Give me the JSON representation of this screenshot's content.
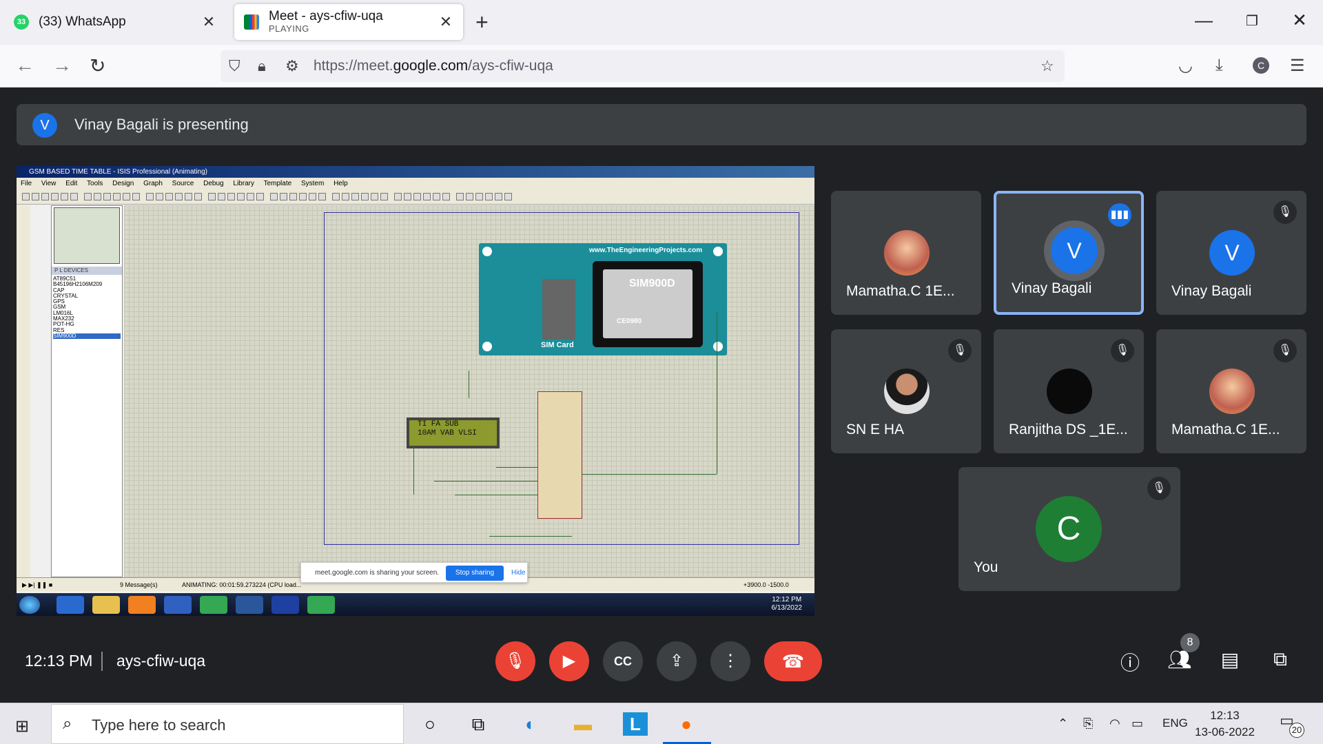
{
  "browser": {
    "tabs": [
      {
        "title": "(33) WhatsApp",
        "badge": "33"
      },
      {
        "title": "Meet - ays-cfiw-uqa",
        "subtitle": "PLAYING"
      }
    ],
    "url_prefix": "https://meet.",
    "url_domain": "google.com",
    "url_path": "/ays-cfiw-uqa",
    "profile_initial": "C"
  },
  "meet": {
    "presenter_initial": "V",
    "presenting_text": "Vinay Bagali is presenting",
    "time": "12:13 PM",
    "meeting_code": "ays-cfiw-uqa",
    "people_count": "8",
    "participants": [
      {
        "name": "Mamatha.C 1E...",
        "muted": false,
        "speaking": false
      },
      {
        "name": "Vinay Bagali",
        "initial": "V",
        "speaking": true
      },
      {
        "name": "Vinay Bagali",
        "initial": "V",
        "muted": true
      },
      {
        "name": "SN E HA",
        "muted": true
      },
      {
        "name": "Ranjitha DS _1E...",
        "muted": true
      },
      {
        "name": "Mamatha.C 1E...",
        "muted": true
      },
      {
        "name": "You",
        "initial": "C",
        "muted": true
      }
    ],
    "colors": {
      "accent": "#1a73e8",
      "danger": "#ea4335",
      "surface": "#3c4043",
      "background": "#202124",
      "you_avatar": "#1e7e34"
    }
  },
  "shared_screen": {
    "window_title": "GSM BASED TIME TABLE - ISIS Professional (Animating)",
    "menu": [
      "File",
      "View",
      "Edit",
      "Tools",
      "Design",
      "Graph",
      "Source",
      "Debug",
      "Library",
      "Template",
      "System",
      "Help"
    ],
    "devices_header": "P  L    DEVICES",
    "devices": [
      "AT89C51",
      "B45196H2106M209",
      "CAP",
      "CRYSTAL",
      "GPS",
      "GSM",
      "LM016L",
      "MAX232",
      "POT-HG",
      "RES",
      "SIM900D"
    ],
    "selected_device": "SIM900D",
    "module_site": "www.TheEngineeringProjects.com",
    "module_chip": "SIM900D",
    "module_ce": "CE0980",
    "module_sim": "SIM Card",
    "lcd_line1": "TI    FA  SUB",
    "lcd_line2": "10AM  VAB  VLSI",
    "status_messages": "9 Message(s)",
    "status_anim": "ANIMATING: 00:01:59.273224 (CPU load...",
    "status_coords": "+3900.0   -1500.0",
    "share_msg": "meet.google.com is sharing your screen.",
    "stop_sharing": "Stop sharing",
    "hide": "Hide",
    "win7_time": "12:12 PM",
    "win7_date": "6/13/2022"
  },
  "taskbar": {
    "search_placeholder": "Type here to search",
    "lang": "ENG",
    "time": "12:13",
    "date": "13-06-2022",
    "notifications": "20"
  }
}
